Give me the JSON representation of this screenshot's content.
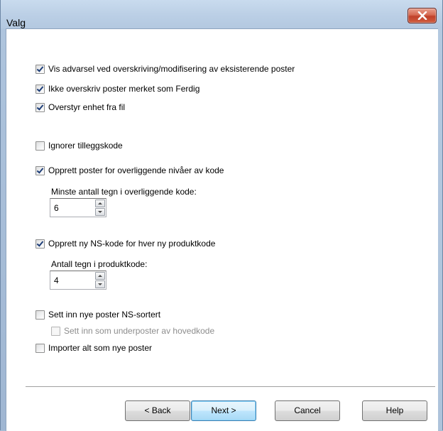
{
  "window": {
    "title": "Valg"
  },
  "options": {
    "warn_overwrite": {
      "label": "Vis advarsel ved overskriving/modifisering av eksisterende poster",
      "checked": true
    },
    "skip_finished": {
      "label": "Ikke overskriv poster merket som Ferdig",
      "checked": true
    },
    "override_unit": {
      "label": "Overstyr enhet fra fil",
      "checked": true
    },
    "ignore_addon_code": {
      "label": "Ignorer tilleggskode",
      "checked": false
    },
    "create_parent_levels": {
      "label": "Opprett poster for overliggende nivåer av kode",
      "checked": true
    },
    "min_chars_label": "Minste antall tegn i overliggende kode:",
    "min_chars_value": "6",
    "create_ns_code": {
      "label": "Opprett ny NS-kode for hver ny produktkode",
      "checked": true
    },
    "product_chars_label": "Antall tegn i produktkode:",
    "product_chars_value": "4",
    "insert_ns_sorted": {
      "label": "Sett inn nye poster NS-sortert",
      "checked": false
    },
    "insert_as_subposts": {
      "label": "Sett inn som underposter av hovedkode",
      "checked": false,
      "disabled": true
    },
    "import_all_new": {
      "label": "Importer alt som nye poster",
      "checked": false
    }
  },
  "buttons": {
    "back": "< Back",
    "next": "Next >",
    "cancel": "Cancel",
    "help": "Help"
  }
}
